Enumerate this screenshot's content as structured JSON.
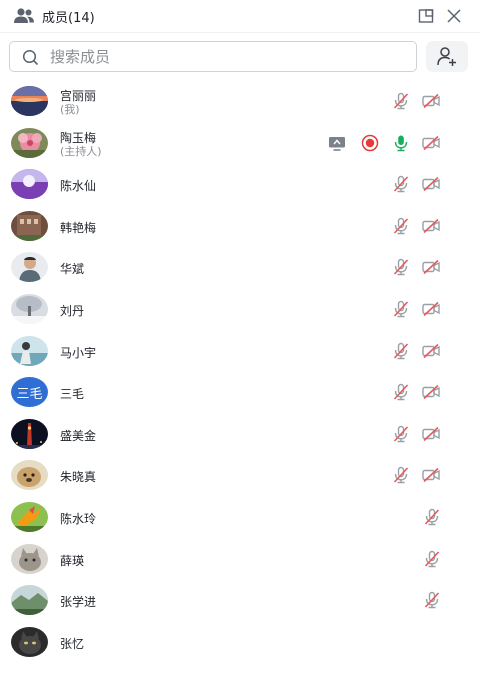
{
  "header": {
    "title": "成员(14)"
  },
  "search": {
    "placeholder": "搜索成员"
  },
  "colors": {
    "muted_red": "#e25b5b",
    "gray_icon": "#9aa0a6",
    "mic_on_green": "#1aad5e",
    "record_red": "#e63a3a",
    "avatar_text_bg": "#2f6fd3"
  },
  "members": [
    {
      "name": "宫丽丽",
      "sub": "(我)",
      "avatar": "sunset",
      "icons": [
        "mic-muted",
        "camera-off"
      ]
    },
    {
      "name": "陶玉梅",
      "sub": "(主持人)",
      "avatar": "flower",
      "icons": [
        "screen-share",
        "recording",
        "mic-on",
        "camera-off"
      ]
    },
    {
      "name": "陈水仙",
      "sub": "",
      "avatar": "purple-field",
      "icons": [
        "mic-muted",
        "camera-off"
      ]
    },
    {
      "name": "韩艳梅",
      "sub": "",
      "avatar": "building",
      "icons": [
        "mic-muted",
        "camera-off"
      ]
    },
    {
      "name": "华斌",
      "sub": "",
      "avatar": "person",
      "icons": [
        "mic-muted",
        "camera-off"
      ]
    },
    {
      "name": "刘丹",
      "sub": "",
      "avatar": "snow-tree",
      "icons": [
        "mic-muted",
        "camera-off"
      ]
    },
    {
      "name": "马小宇",
      "sub": "",
      "avatar": "person-water",
      "icons": [
        "mic-muted",
        "camera-off"
      ]
    },
    {
      "name": "三毛",
      "sub": "",
      "avatar_text": "三毛",
      "avatar": "text",
      "icons": [
        "mic-muted",
        "camera-off"
      ]
    },
    {
      "name": "盛美金",
      "sub": "",
      "avatar": "night-tower",
      "icons": [
        "mic-muted",
        "camera-off"
      ]
    },
    {
      "name": "朱晓真",
      "sub": "",
      "avatar": "dog",
      "icons": [
        "mic-muted",
        "camera-off"
      ]
    },
    {
      "name": "陈水玲",
      "sub": "",
      "avatar": "bird-flower",
      "icons": [
        "mic-muted"
      ]
    },
    {
      "name": "薛瑛",
      "sub": "",
      "avatar": "cat",
      "icons": [
        "mic-muted"
      ]
    },
    {
      "name": "张学进",
      "sub": "",
      "avatar": "landscape",
      "icons": [
        "mic-muted"
      ]
    },
    {
      "name": "张忆",
      "sub": "",
      "avatar": "dark-cat",
      "icons": []
    }
  ]
}
